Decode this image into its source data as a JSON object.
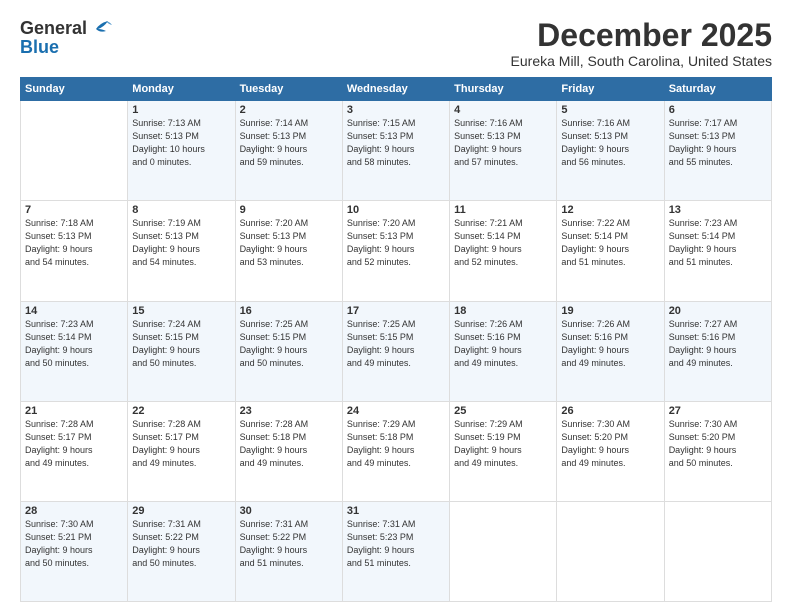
{
  "header": {
    "logo_general": "General",
    "logo_blue": "Blue",
    "title": "December 2025",
    "subtitle": "Eureka Mill, South Carolina, United States"
  },
  "weekdays": [
    "Sunday",
    "Monday",
    "Tuesday",
    "Wednesday",
    "Thursday",
    "Friday",
    "Saturday"
  ],
  "weeks": [
    [
      {
        "day": "",
        "info": ""
      },
      {
        "day": "1",
        "info": "Sunrise: 7:13 AM\nSunset: 5:13 PM\nDaylight: 10 hours\nand 0 minutes."
      },
      {
        "day": "2",
        "info": "Sunrise: 7:14 AM\nSunset: 5:13 PM\nDaylight: 9 hours\nand 59 minutes."
      },
      {
        "day": "3",
        "info": "Sunrise: 7:15 AM\nSunset: 5:13 PM\nDaylight: 9 hours\nand 58 minutes."
      },
      {
        "day": "4",
        "info": "Sunrise: 7:16 AM\nSunset: 5:13 PM\nDaylight: 9 hours\nand 57 minutes."
      },
      {
        "day": "5",
        "info": "Sunrise: 7:16 AM\nSunset: 5:13 PM\nDaylight: 9 hours\nand 56 minutes."
      },
      {
        "day": "6",
        "info": "Sunrise: 7:17 AM\nSunset: 5:13 PM\nDaylight: 9 hours\nand 55 minutes."
      }
    ],
    [
      {
        "day": "7",
        "info": "Sunrise: 7:18 AM\nSunset: 5:13 PM\nDaylight: 9 hours\nand 54 minutes."
      },
      {
        "day": "8",
        "info": "Sunrise: 7:19 AM\nSunset: 5:13 PM\nDaylight: 9 hours\nand 54 minutes."
      },
      {
        "day": "9",
        "info": "Sunrise: 7:20 AM\nSunset: 5:13 PM\nDaylight: 9 hours\nand 53 minutes."
      },
      {
        "day": "10",
        "info": "Sunrise: 7:20 AM\nSunset: 5:13 PM\nDaylight: 9 hours\nand 52 minutes."
      },
      {
        "day": "11",
        "info": "Sunrise: 7:21 AM\nSunset: 5:14 PM\nDaylight: 9 hours\nand 52 minutes."
      },
      {
        "day": "12",
        "info": "Sunrise: 7:22 AM\nSunset: 5:14 PM\nDaylight: 9 hours\nand 51 minutes."
      },
      {
        "day": "13",
        "info": "Sunrise: 7:23 AM\nSunset: 5:14 PM\nDaylight: 9 hours\nand 51 minutes."
      }
    ],
    [
      {
        "day": "14",
        "info": "Sunrise: 7:23 AM\nSunset: 5:14 PM\nDaylight: 9 hours\nand 50 minutes."
      },
      {
        "day": "15",
        "info": "Sunrise: 7:24 AM\nSunset: 5:15 PM\nDaylight: 9 hours\nand 50 minutes."
      },
      {
        "day": "16",
        "info": "Sunrise: 7:25 AM\nSunset: 5:15 PM\nDaylight: 9 hours\nand 50 minutes."
      },
      {
        "day": "17",
        "info": "Sunrise: 7:25 AM\nSunset: 5:15 PM\nDaylight: 9 hours\nand 49 minutes."
      },
      {
        "day": "18",
        "info": "Sunrise: 7:26 AM\nSunset: 5:16 PM\nDaylight: 9 hours\nand 49 minutes."
      },
      {
        "day": "19",
        "info": "Sunrise: 7:26 AM\nSunset: 5:16 PM\nDaylight: 9 hours\nand 49 minutes."
      },
      {
        "day": "20",
        "info": "Sunrise: 7:27 AM\nSunset: 5:16 PM\nDaylight: 9 hours\nand 49 minutes."
      }
    ],
    [
      {
        "day": "21",
        "info": "Sunrise: 7:28 AM\nSunset: 5:17 PM\nDaylight: 9 hours\nand 49 minutes."
      },
      {
        "day": "22",
        "info": "Sunrise: 7:28 AM\nSunset: 5:17 PM\nDaylight: 9 hours\nand 49 minutes."
      },
      {
        "day": "23",
        "info": "Sunrise: 7:28 AM\nSunset: 5:18 PM\nDaylight: 9 hours\nand 49 minutes."
      },
      {
        "day": "24",
        "info": "Sunrise: 7:29 AM\nSunset: 5:18 PM\nDaylight: 9 hours\nand 49 minutes."
      },
      {
        "day": "25",
        "info": "Sunrise: 7:29 AM\nSunset: 5:19 PM\nDaylight: 9 hours\nand 49 minutes."
      },
      {
        "day": "26",
        "info": "Sunrise: 7:30 AM\nSunset: 5:20 PM\nDaylight: 9 hours\nand 49 minutes."
      },
      {
        "day": "27",
        "info": "Sunrise: 7:30 AM\nSunset: 5:20 PM\nDaylight: 9 hours\nand 50 minutes."
      }
    ],
    [
      {
        "day": "28",
        "info": "Sunrise: 7:30 AM\nSunset: 5:21 PM\nDaylight: 9 hours\nand 50 minutes."
      },
      {
        "day": "29",
        "info": "Sunrise: 7:31 AM\nSunset: 5:22 PM\nDaylight: 9 hours\nand 50 minutes."
      },
      {
        "day": "30",
        "info": "Sunrise: 7:31 AM\nSunset: 5:22 PM\nDaylight: 9 hours\nand 51 minutes."
      },
      {
        "day": "31",
        "info": "Sunrise: 7:31 AM\nSunset: 5:23 PM\nDaylight: 9 hours\nand 51 minutes."
      },
      {
        "day": "",
        "info": ""
      },
      {
        "day": "",
        "info": ""
      },
      {
        "day": "",
        "info": ""
      }
    ]
  ]
}
